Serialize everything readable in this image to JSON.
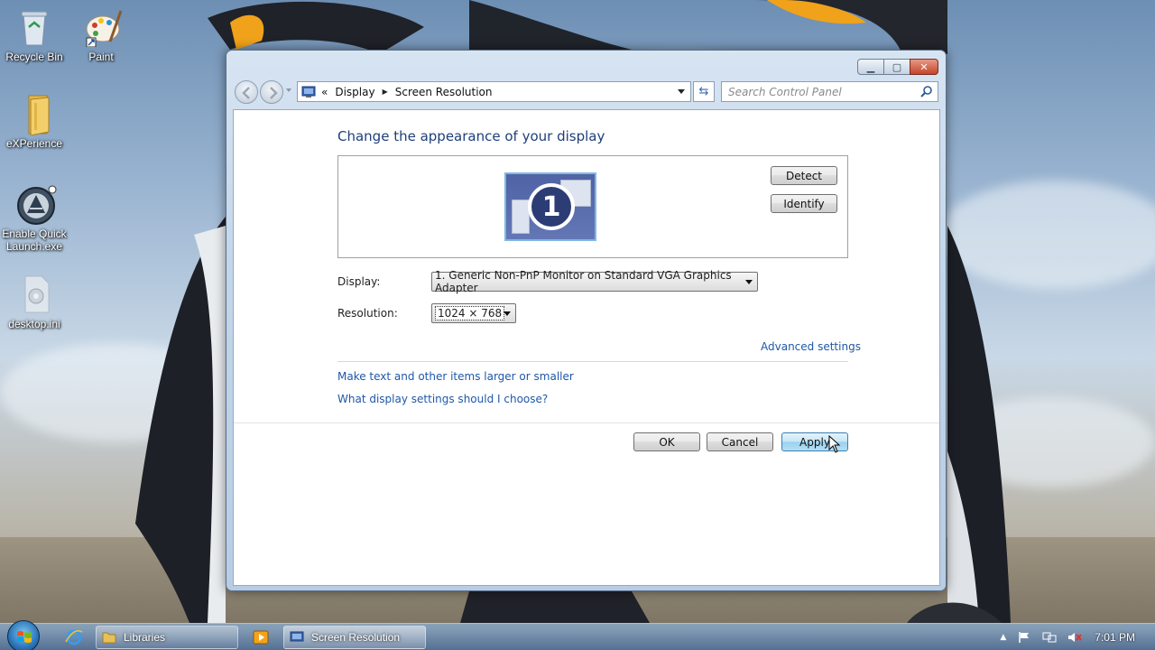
{
  "desktop": {
    "icons": [
      {
        "label": "Recycle Bin"
      },
      {
        "label": "Paint"
      },
      {
        "label": "eXPerience"
      },
      {
        "label": "Enable Quick Launch.exe"
      },
      {
        "label": "desktop.ini"
      }
    ]
  },
  "window": {
    "breadcrumb": {
      "chevron": "«",
      "items": [
        "Display",
        "Screen Resolution"
      ]
    },
    "search_placeholder": "Search Control Panel",
    "heading": "Change the appearance of your display",
    "monitor_number": "1",
    "detect_label": "Detect",
    "identify_label": "Identify",
    "display_label": "Display:",
    "display_value": "1. Generic Non-PnP Monitor on Standard VGA Graphics Adapter",
    "resolution_label": "Resolution:",
    "resolution_value": "1024 × 768",
    "advanced_link": "Advanced settings",
    "link_larger": "Make text and other items larger or smaller",
    "link_choose": "What display settings should I choose?",
    "ok_label": "OK",
    "cancel_label": "Cancel",
    "apply_label": "Apply"
  },
  "taskbar": {
    "buttons": [
      {
        "label": "Libraries"
      },
      {
        "label": "Screen Resolution"
      }
    ],
    "clock": "7:01 PM"
  },
  "colors": {
    "link": "#1e58a8",
    "heading": "#1e3f7a",
    "focused_button": "#98d1ef"
  }
}
